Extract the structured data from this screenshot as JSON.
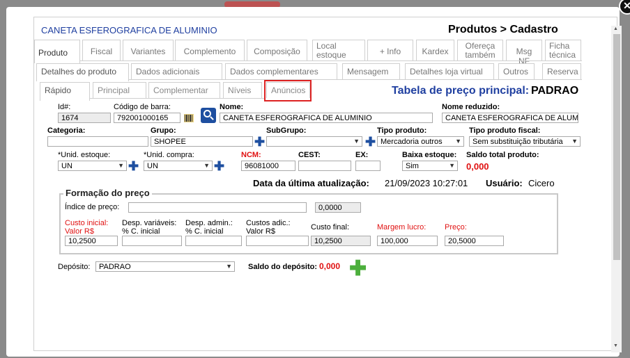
{
  "header": {
    "product_name": "CANETA ESFEROGRAFICA DE ALUMINIO",
    "breadcrumb": "Produtos > Cadastro"
  },
  "tabs_main": [
    "Produto",
    "Fiscal",
    "Variantes",
    "Complemento",
    "Composição",
    "Local estoque",
    "+ Info",
    "Kardex",
    "Ofereça também",
    "Msg NF",
    "Ficha técnica"
  ],
  "tabs_second": [
    "Detalhes do produto",
    "Dados adicionais",
    "Dados complementares",
    "Mensagem",
    "Detalhes loja virtual",
    "Outros",
    "Reserva"
  ],
  "tabs_third": [
    "Rápido",
    "Principal",
    "Complementar",
    "Níveis",
    "Anúncios"
  ],
  "price_table": {
    "label": "Tabela de preço principal:",
    "value": "PADRAO"
  },
  "form": {
    "id_label": "Id#:",
    "id_value": "1674",
    "barcode_label": "Código de barra:",
    "barcode_value": "792001000165",
    "name_label": "Nome:",
    "name_value": "CANETA ESFEROGRAFICA DE ALUMINIO",
    "short_name_label": "Nome reduzido:",
    "short_name_value": "CANETA ESFEROGRAFICA DE ALUM",
    "category_label": "Categoria:",
    "category_value": "",
    "group_label": "Grupo:",
    "group_value": "SHOPEE",
    "subgroup_label": "SubGrupo:",
    "subgroup_value": "",
    "product_type_label": "Tipo produto:",
    "product_type_value": "Mercadoria outros",
    "fiscal_type_label": "Tipo produto fiscal:",
    "fiscal_type_value": "Sem substituição tributária",
    "stock_unit_label": "*Unid. estoque:",
    "stock_unit_value": "UN",
    "purchase_unit_label": "*Unid. compra:",
    "purchase_unit_value": "UN",
    "ncm_label": "NCM:",
    "ncm_value": "96081000",
    "cest_label": "CEST:",
    "cest_value": "",
    "ex_label": "EX:",
    "ex_value": "",
    "stock_drop_label": "Baixa estoque:",
    "stock_drop_value": "Sim",
    "total_balance_label": "Saldo total produto:",
    "total_balance_value": "0,000",
    "last_update_label": "Data da última atualização:",
    "last_update_value": "21/09/2023 10:27:01",
    "user_label": "Usuário:",
    "user_value": "Cicero"
  },
  "pricing": {
    "legend": "Formação do preço",
    "price_index_label": "Índice de preço:",
    "price_index_value": "",
    "price_index_num": "0,0000",
    "initial_cost_label_1": "Custo inicial:",
    "initial_cost_label_2": "Valor R$",
    "var_exp_label_1": "Desp. variáveis:",
    "var_exp_label_2": "% C. inicial",
    "admin_exp_label_1": "Desp. admin.:",
    "admin_exp_label_2": "% C. inicial",
    "add_cost_label_1": "Custos adic.:",
    "add_cost_label_2": "Valor R$",
    "final_cost_label": "Custo final:",
    "margin_label": "Margem lucro:",
    "price_label": "Preço:",
    "initial_cost_value": "10,2500",
    "var_exp_value": "",
    "admin_exp_value": "",
    "add_cost_value": "",
    "final_cost_value": "10,2500",
    "margin_value": "100,000",
    "price_value": "20,5000"
  },
  "deposit": {
    "label": "Depósito:",
    "value": "PADRAO",
    "balance_label": "Saldo do depósito:",
    "balance_value": "0,000"
  },
  "icons": {
    "close": "close-icon",
    "search": "search-icon",
    "barcode": "barcode-icon",
    "plus": "plus-icon",
    "add_green": "plus-icon"
  },
  "colors": {
    "accent_blue": "#1f3fa0",
    "required_red": "#e01010",
    "highlight_red": "#d22222",
    "add_green": "#4caf3c"
  }
}
